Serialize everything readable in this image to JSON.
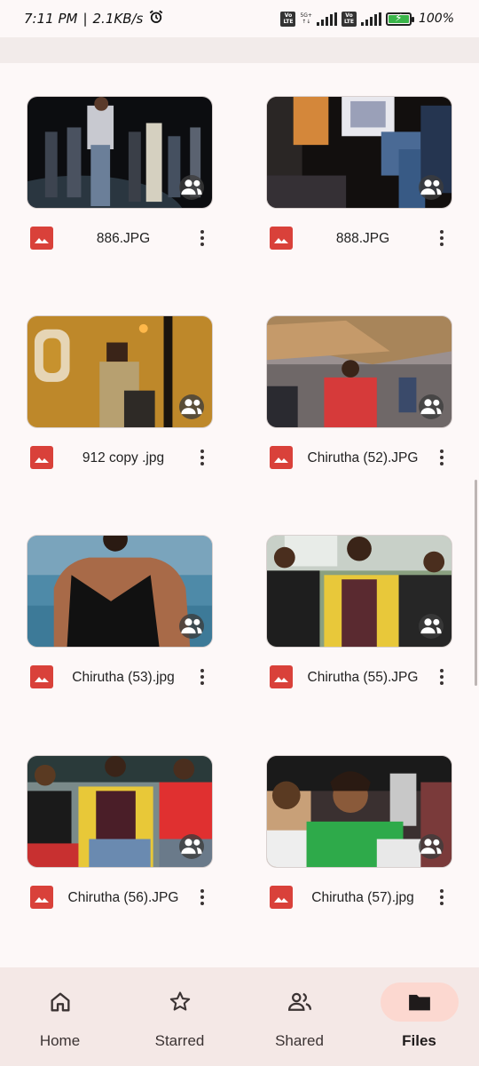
{
  "status_bar": {
    "time": "7:11 PM",
    "separator": "|",
    "net_speed": "2.1KB/s",
    "volte1": "Vo LTE",
    "network1": "5G+",
    "volte2": "Vo LTE",
    "battery": "100%"
  },
  "files": [
    {
      "name": "886.JPG",
      "type_icon": "image-icon",
      "shared": true
    },
    {
      "name": "888.JPG",
      "type_icon": "image-icon",
      "shared": true
    },
    {
      "name": "912 copy .jpg",
      "type_icon": "image-icon",
      "shared": true
    },
    {
      "name": "Chirutha (52).JPG",
      "type_icon": "image-icon",
      "shared": true
    },
    {
      "name": "Chirutha (53).jpg",
      "type_icon": "image-icon",
      "shared": true
    },
    {
      "name": "Chirutha (55).JPG",
      "type_icon": "image-icon",
      "shared": true
    },
    {
      "name": "Chirutha (56).JPG",
      "type_icon": "image-icon",
      "shared": true
    },
    {
      "name": "Chirutha (57).jpg",
      "type_icon": "image-icon",
      "shared": true
    }
  ],
  "bottom_nav": {
    "items": [
      {
        "label": "Home",
        "icon": "home-icon",
        "active": false
      },
      {
        "label": "Starred",
        "icon": "star-icon",
        "active": false
      },
      {
        "label": "Shared",
        "icon": "people-icon",
        "active": false
      },
      {
        "label": "Files",
        "icon": "folder-icon",
        "active": true
      }
    ]
  },
  "colors": {
    "background": "#fdf8f8",
    "nav_background": "#f4e8e6",
    "active_pill": "#fcd8d0",
    "image_type_red": "#d9413a"
  }
}
